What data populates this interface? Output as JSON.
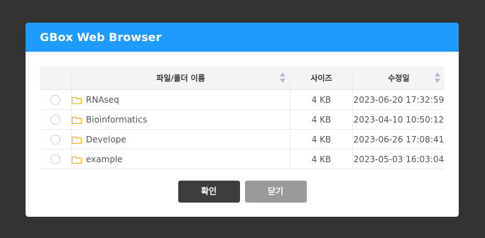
{
  "dialog": {
    "title": "GBox Web Browser",
    "header_color": "#1e9bfb"
  },
  "table": {
    "headers": {
      "name": "파일/폴더 이름",
      "size": "사이즈",
      "modified": "수정일"
    },
    "sortable_columns": [
      "name",
      "modified"
    ],
    "rows": [
      {
        "icon": "folder-icon",
        "name": "RNAseq",
        "size": "4 KB",
        "modified": "2023-06-20 17:32:59"
      },
      {
        "icon": "folder-icon",
        "name": "Bioinformatics",
        "size": "4 KB",
        "modified": "2023-04-10 10:50:12"
      },
      {
        "icon": "folder-icon",
        "name": "Develope",
        "size": "4 KB",
        "modified": "2023-06-26 17:08:41"
      },
      {
        "icon": "folder-icon",
        "name": "example",
        "size": "4 KB",
        "modified": "2023-05-03 16:03:04"
      }
    ]
  },
  "buttons": {
    "confirm": "확인",
    "close": "닫기"
  }
}
